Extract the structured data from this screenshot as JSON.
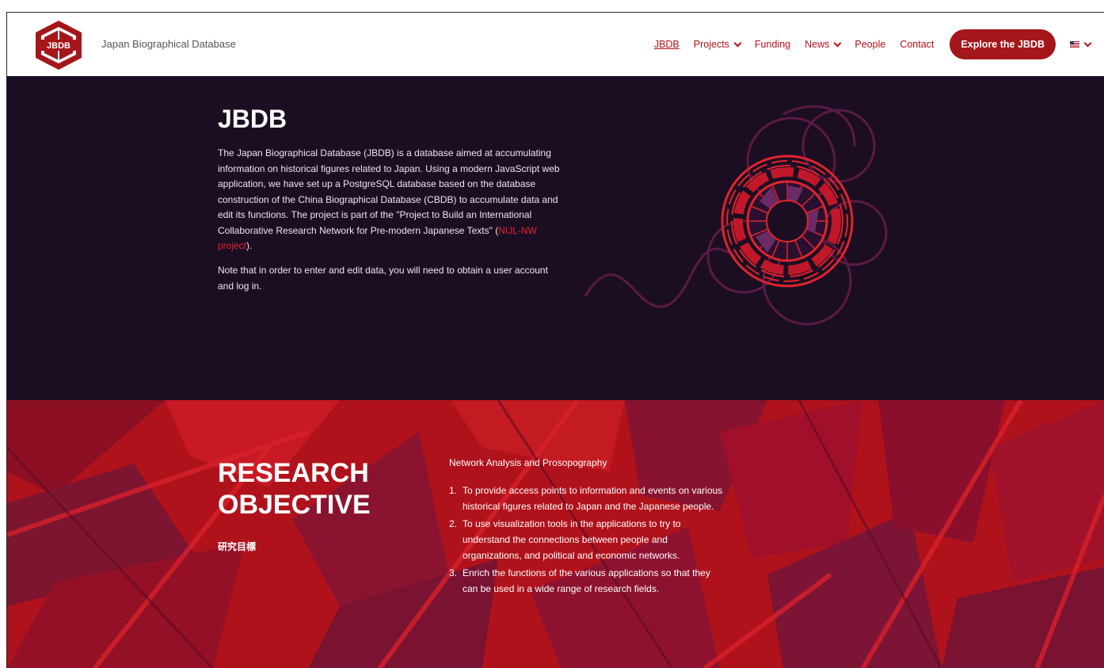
{
  "header": {
    "logo_text": "JBDB",
    "site_name": "Japan Biographical Database",
    "nav": [
      {
        "label": "JBDB",
        "active": true,
        "dropdown": false
      },
      {
        "label": "Projects",
        "active": false,
        "dropdown": true
      },
      {
        "label": "Funding",
        "active": false,
        "dropdown": false
      },
      {
        "label": "News",
        "active": false,
        "dropdown": true
      },
      {
        "label": "People",
        "active": false,
        "dropdown": false
      },
      {
        "label": "Contact",
        "active": false,
        "dropdown": false
      }
    ],
    "cta_label": "Explore the JBDB",
    "language_icon": "us-flag-icon"
  },
  "hero": {
    "title": "JBDB",
    "paragraph_before_link": "The Japan Biographical Database (JBDB) is a database aimed at accumulating information on historical figures related to Japan. Using a modern JavaScript web application, we have set up a PostgreSQL database based on the database construction of the China Biographical Database (CBDB) to accumulate data and edit its functions. The project is part of the \"Project to Build an International Collaborative Research Network for Pre-modern Japanese Texts\" (",
    "link_text": "NIJL-NW project",
    "paragraph_after_link": ").",
    "note": "Note that in order to enter and edit data, you will need to obtain a user account and log in."
  },
  "research": {
    "title_line1": "RESEARCH",
    "title_line2": "OBJECTIVE",
    "subtitle": "研究目標",
    "heading": "Network Analysis and Prosopography",
    "objectives": [
      {
        "num": "1.",
        "text": "To provide access points to information and events on various historical figures related to Japan and the Japanese people."
      },
      {
        "num": "2.",
        "text": "To use visualization tools in the applications to try to understand the connections between people and organizations, and political and economic networks."
      },
      {
        "num": "3.",
        "text": "Enrich the functions of the various applications so that they can be used in a wide range of research fields."
      }
    ]
  },
  "colors": {
    "brand_red": "#a4161a",
    "link_red": "#b5121b",
    "hero_bg": "#1c0e22",
    "research_bg": "#b0121c"
  }
}
